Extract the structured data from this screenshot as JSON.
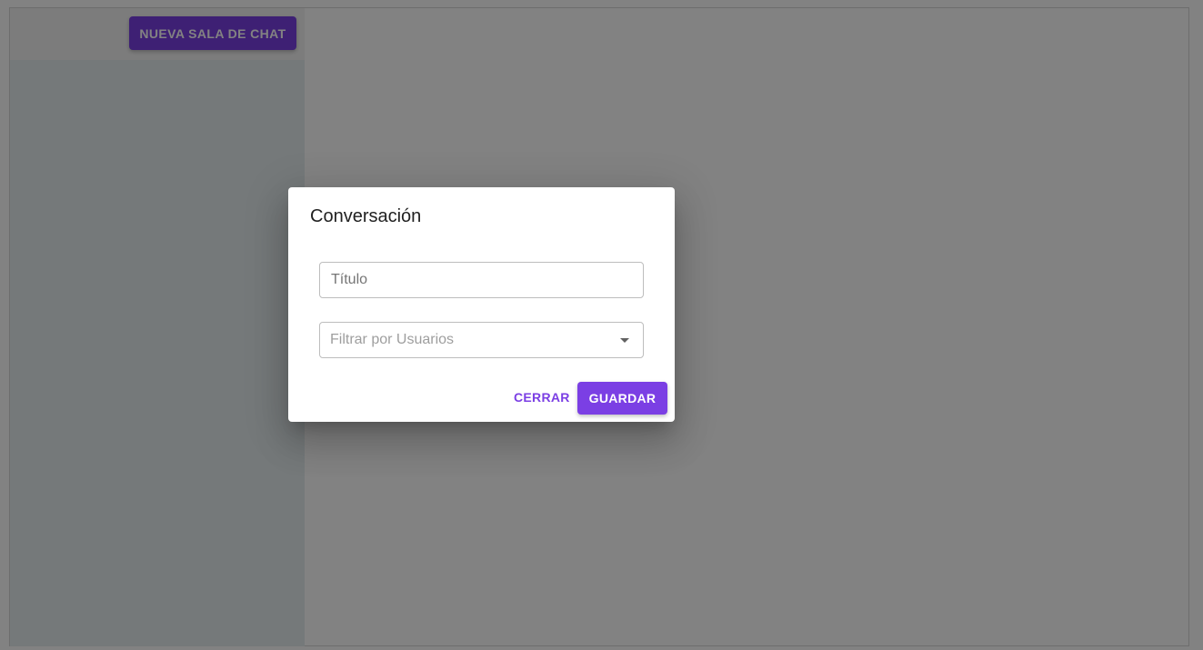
{
  "toolbar": {
    "new_room_label": "NUEVA SALA DE CHAT"
  },
  "dialog": {
    "title": "Conversación",
    "title_field": {
      "placeholder": "Título",
      "value": ""
    },
    "users_select": {
      "placeholder": "Filtrar por Usuarios",
      "icon": "chevron-down-icon"
    },
    "close_label": "CERRAR",
    "save_label": "GUARDAR"
  },
  "colors": {
    "accent": "#7b3fe4",
    "sidebar": "#e6eef0",
    "backdrop": "rgba(0,0,0,0.49)"
  }
}
